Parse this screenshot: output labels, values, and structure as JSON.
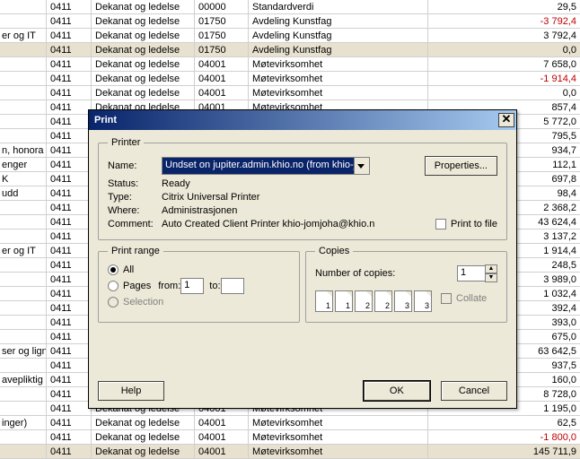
{
  "dialog": {
    "title": "Print",
    "printer_legend": "Printer",
    "name_label": "Name:",
    "name_value": "Undset on jupiter.admin.khio.no (from khio-j",
    "properties_btn": "Properties...",
    "status_label": "Status:",
    "status_value": "Ready",
    "type_label": "Type:",
    "type_value": "Citrix Universal Printer",
    "where_label": "Where:",
    "where_value": "Administrasjonen",
    "comment_label": "Comment:",
    "comment_value": "Auto Created Client Printer khio-jomjoha@khio.n",
    "print_to_file": "Print to file",
    "range_legend": "Print range",
    "range_all": "All",
    "range_pages": "Pages",
    "range_from": "from:",
    "range_from_value": "1",
    "range_to": "to:",
    "range_to_value": "",
    "range_selection": "Selection",
    "copies_legend": "Copies",
    "copies_label": "Number of copies:",
    "copies_value": "1",
    "collate": "Collate",
    "help_btn": "Help",
    "ok_btn": "OK",
    "cancel_btn": "Cancel"
  },
  "rows": [
    {
      "c0": "",
      "c1": "0411",
      "c2": "Dekanat og ledelse",
      "c3": "00000",
      "c4": "Standardverdi",
      "c5": "29,5",
      "neg": false,
      "hl": false
    },
    {
      "c0": "",
      "c1": "0411",
      "c2": "Dekanat og ledelse",
      "c3": "01750",
      "c4": "Avdeling Kunstfag",
      "c5": "-3 792,4",
      "neg": true,
      "hl": false
    },
    {
      "c0": "er og IT",
      "c1": "0411",
      "c2": "Dekanat og ledelse",
      "c3": "01750",
      "c4": "Avdeling Kunstfag",
      "c5": "3 792,4",
      "neg": false,
      "hl": false
    },
    {
      "c0": "",
      "c1": "0411",
      "c2": "Dekanat og ledelse",
      "c3": "01750",
      "c4": "Avdeling Kunstfag",
      "c5": "0,0",
      "neg": false,
      "hl": true
    },
    {
      "c0": "",
      "c1": "0411",
      "c2": "Dekanat og ledelse",
      "c3": "04001",
      "c4": "Møtevirksomhet",
      "c5": "7 658,0",
      "neg": false,
      "hl": false
    },
    {
      "c0": "",
      "c1": "0411",
      "c2": "Dekanat og ledelse",
      "c3": "04001",
      "c4": "Møtevirksomhet",
      "c5": "-1 914,4",
      "neg": true,
      "hl": false
    },
    {
      "c0": "",
      "c1": "0411",
      "c2": "Dekanat og ledelse",
      "c3": "04001",
      "c4": "Møtevirksomhet",
      "c5": "0,0",
      "neg": false,
      "hl": false
    },
    {
      "c0": "",
      "c1": "0411",
      "c2": "Dekanat og ledelse",
      "c3": "04001",
      "c4": "Møtevirksomhet",
      "c5": "857,4",
      "neg": false,
      "hl": false
    },
    {
      "c0": "",
      "c1": "0411",
      "c2": "",
      "c3": "",
      "c4": "",
      "c5": "5 772,0",
      "neg": false,
      "hl": false
    },
    {
      "c0": "",
      "c1": "0411",
      "c2": "",
      "c3": "",
      "c4": "",
      "c5": "795,5",
      "neg": false,
      "hl": false
    },
    {
      "c0": "n, honora",
      "c1": "0411",
      "c2": "",
      "c3": "",
      "c4": "",
      "c5": "934,7",
      "neg": false,
      "hl": false
    },
    {
      "c0": "enger",
      "c1": "0411",
      "c2": "",
      "c3": "",
      "c4": "",
      "c5": "112,1",
      "neg": false,
      "hl": false
    },
    {
      "c0": "K",
      "c1": "0411",
      "c2": "",
      "c3": "",
      "c4": "",
      "c5": "697,8",
      "neg": false,
      "hl": false
    },
    {
      "c0": "udd",
      "c1": "0411",
      "c2": "",
      "c3": "",
      "c4": "",
      "c5": "98,4",
      "neg": false,
      "hl": false
    },
    {
      "c0": "",
      "c1": "0411",
      "c2": "",
      "c3": "",
      "c4": "",
      "c5": "2 368,2",
      "neg": false,
      "hl": false
    },
    {
      "c0": "",
      "c1": "0411",
      "c2": "",
      "c3": "",
      "c4": "",
      "c5": "43 624,4",
      "neg": false,
      "hl": false
    },
    {
      "c0": "",
      "c1": "0411",
      "c2": "",
      "c3": "",
      "c4": "",
      "c5": "3 137,2",
      "neg": false,
      "hl": false
    },
    {
      "c0": "er og IT",
      "c1": "0411",
      "c2": "",
      "c3": "",
      "c4": "",
      "c5": "1 914,4",
      "neg": false,
      "hl": false
    },
    {
      "c0": "",
      "c1": "0411",
      "c2": "",
      "c3": "",
      "c4": "",
      "c5": "248,5",
      "neg": false,
      "hl": false
    },
    {
      "c0": "",
      "c1": "0411",
      "c2": "",
      "c3": "",
      "c4": "",
      "c5": "3 989,0",
      "neg": false,
      "hl": false
    },
    {
      "c0": "",
      "c1": "0411",
      "c2": "",
      "c3": "",
      "c4": "",
      "c5": "1 032,4",
      "neg": false,
      "hl": false
    },
    {
      "c0": "",
      "c1": "0411",
      "c2": "",
      "c3": "",
      "c4": "",
      "c5": "392,4",
      "neg": false,
      "hl": false
    },
    {
      "c0": "",
      "c1": "0411",
      "c2": "",
      "c3": "",
      "c4": "",
      "c5": "393,0",
      "neg": false,
      "hl": false
    },
    {
      "c0": "",
      "c1": "0411",
      "c2": "",
      "c3": "",
      "c4": "",
      "c5": "675,0",
      "neg": false,
      "hl": false
    },
    {
      "c0": "ser og ligne",
      "c1": "0411",
      "c2": "",
      "c3": "",
      "c4": "",
      "c5": "63 642,5",
      "neg": false,
      "hl": false
    },
    {
      "c0": "",
      "c1": "0411",
      "c2": "",
      "c3": "",
      "c4": "",
      "c5": "937,5",
      "neg": false,
      "hl": false
    },
    {
      "c0": "avepliktig",
      "c1": "0411",
      "c2": "",
      "c3": "",
      "c4": "",
      "c5": "160,0",
      "neg": false,
      "hl": false
    },
    {
      "c0": "",
      "c1": "0411",
      "c2": "",
      "c3": "",
      "c4": "",
      "c5": "8 728,0",
      "neg": false,
      "hl": false
    },
    {
      "c0": "",
      "c1": "0411",
      "c2": "Dekanat og ledelse",
      "c3": "04001",
      "c4": "Møtevirksomhet",
      "c5": "1 195,0",
      "neg": false,
      "hl": false
    },
    {
      "c0": "inger)",
      "c1": "0411",
      "c2": "Dekanat og ledelse",
      "c3": "04001",
      "c4": "Møtevirksomhet",
      "c5": "62,5",
      "neg": false,
      "hl": false
    },
    {
      "c0": "",
      "c1": "0411",
      "c2": "Dekanat og ledelse",
      "c3": "04001",
      "c4": "Møtevirksomhet",
      "c5": "-1 800,0",
      "neg": true,
      "hl": false
    },
    {
      "c0": "",
      "c1": "0411",
      "c2": "Dekanat og ledelse",
      "c3": "04001",
      "c4": "Møtevirksomhet",
      "c5": "145 711,9",
      "neg": false,
      "hl": true
    }
  ]
}
